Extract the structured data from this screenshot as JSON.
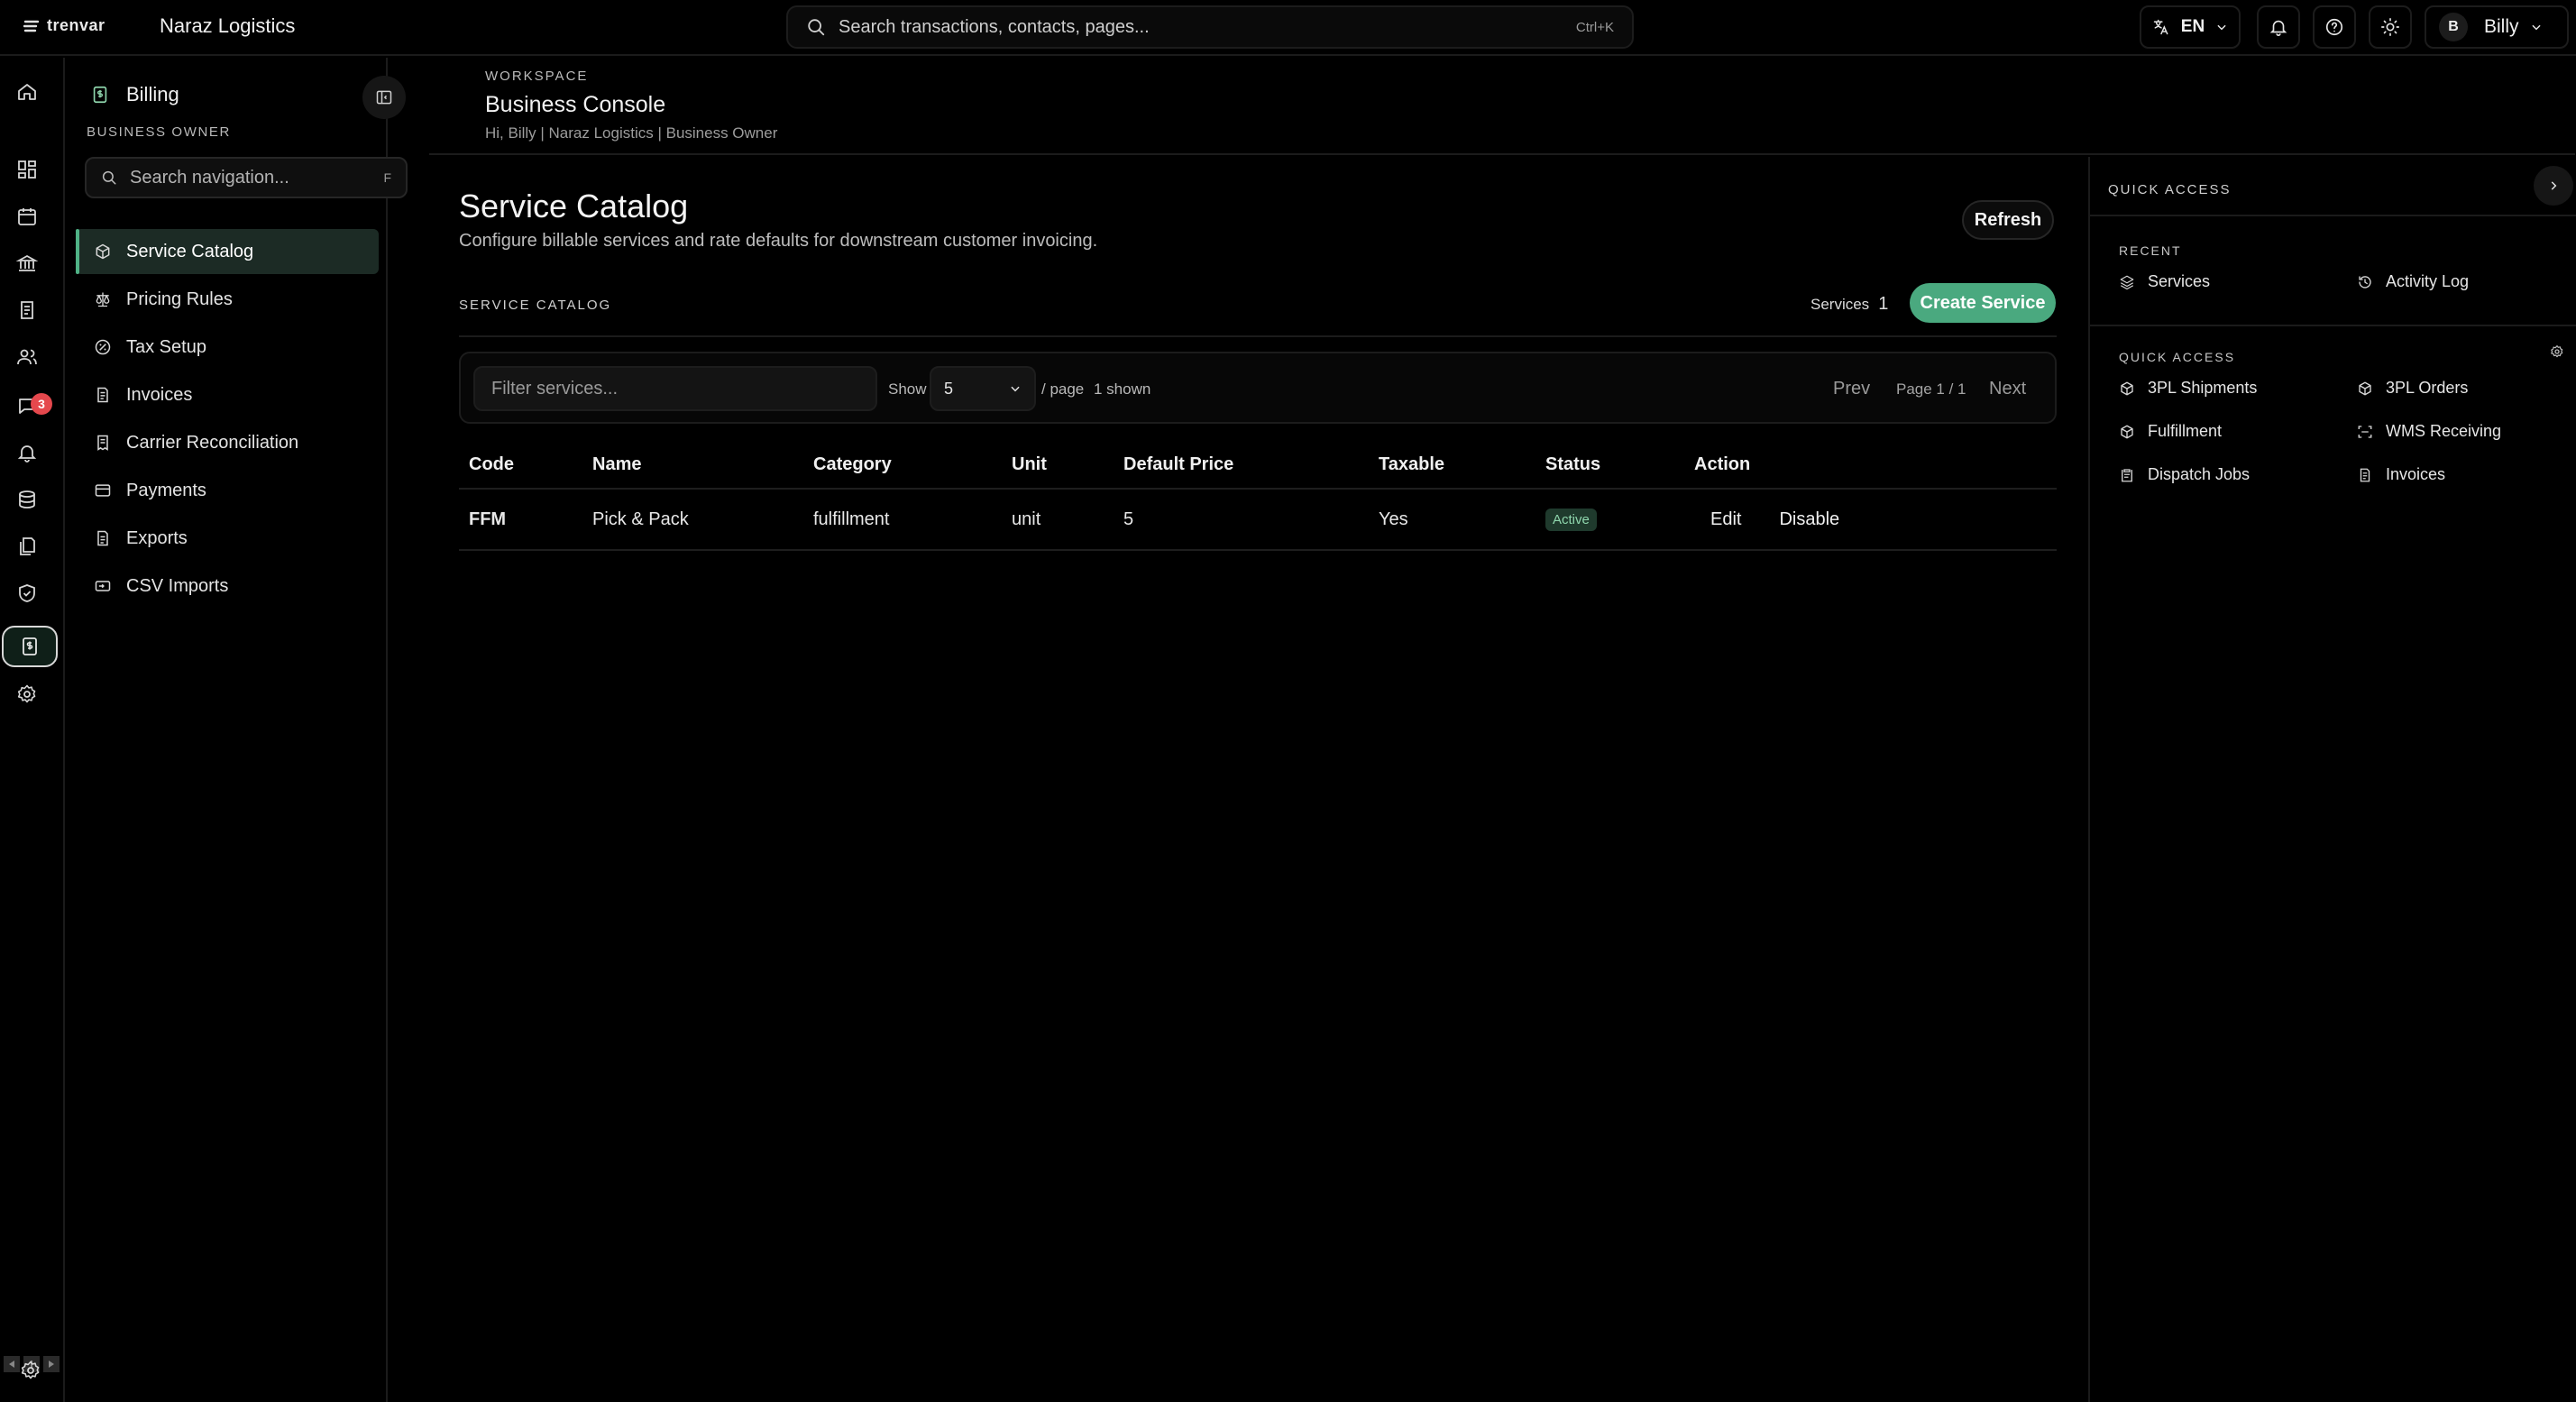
{
  "topbar": {
    "brand": "trenvar",
    "org": "Naraz Logistics",
    "search_placeholder": "Search transactions, contacts, pages...",
    "search_shortcut": "Ctrl+K",
    "language": "EN",
    "user_initial": "B",
    "user_name": "Billy"
  },
  "rail": {
    "items": [
      "home-icon",
      "dashboard-icon",
      "calendar-icon",
      "bank-icon",
      "ledger-icon",
      "users-icon",
      "messages-icon",
      "bell-icon",
      "database-icon",
      "documents-icon",
      "shield-icon",
      "billing-icon",
      "gear-icon"
    ],
    "active": "billing-icon",
    "messages_badge": "3"
  },
  "sidebar": {
    "title": "Billing",
    "role": "BUSINESS OWNER",
    "search_placeholder": "Search navigation...",
    "search_key": "F",
    "items": [
      {
        "label": "Service Catalog",
        "icon": "box-icon",
        "active": true
      },
      {
        "label": "Pricing Rules",
        "icon": "scale-icon"
      },
      {
        "label": "Tax Setup",
        "icon": "percent-icon"
      },
      {
        "label": "Invoices",
        "icon": "invoice-icon"
      },
      {
        "label": "Carrier Reconciliation",
        "icon": "receipt-icon"
      },
      {
        "label": "Payments",
        "icon": "card-icon"
      },
      {
        "label": "Exports",
        "icon": "export-icon"
      },
      {
        "label": "CSV Imports",
        "icon": "import-icon"
      }
    ]
  },
  "workspace": {
    "eyebrow": "WORKSPACE",
    "title": "Business Console",
    "subtitle": "Hi, Billy | Naraz Logistics | Business Owner"
  },
  "main": {
    "title": "Service Catalog",
    "description": "Configure billable services and rate defaults for downstream customer invoicing.",
    "refresh_label": "Refresh",
    "section_label": "SERVICE CATALOG",
    "services_label": "Services",
    "services_count": "1",
    "create_label": "Create Service",
    "filter_placeholder": "Filter services...",
    "show_label": "Show",
    "page_size": "5",
    "per_page_label": "/ page",
    "shown_label": "1 shown",
    "prev_label": "Prev",
    "page_info": "Page 1 / 1",
    "next_label": "Next",
    "columns": [
      "Code",
      "Name",
      "Category",
      "Unit",
      "Default Price",
      "Taxable",
      "Status",
      "Action"
    ],
    "rows": [
      {
        "code": "FFM",
        "name": "Pick & Pack",
        "category": "fulfillment",
        "unit": "unit",
        "price": "5",
        "taxable": "Yes",
        "status": "Active",
        "edit": "Edit",
        "disable": "Disable"
      }
    ]
  },
  "quick_access": {
    "title": "QUICK ACCESS",
    "recent_label": "RECENT",
    "recent": [
      {
        "label": "Services",
        "icon": "layers-icon"
      },
      {
        "label": "Activity Log",
        "icon": "history-icon"
      }
    ],
    "quick_label": "QUICK ACCESS",
    "quick": [
      {
        "label": "3PL Shipments",
        "icon": "box-icon"
      },
      {
        "label": "3PL Orders",
        "icon": "box-icon"
      },
      {
        "label": "Fulfillment",
        "icon": "box-icon"
      },
      {
        "label": "WMS Receiving",
        "icon": "scan-icon"
      },
      {
        "label": "Dispatch Jobs",
        "icon": "clipboard-icon"
      },
      {
        "label": "Invoices",
        "icon": "invoice-icon"
      }
    ]
  },
  "colors": {
    "accent": "#4aa97f",
    "active_nav_bg": "#1c2b25",
    "badge": "#e5484d",
    "background": "#000000"
  }
}
